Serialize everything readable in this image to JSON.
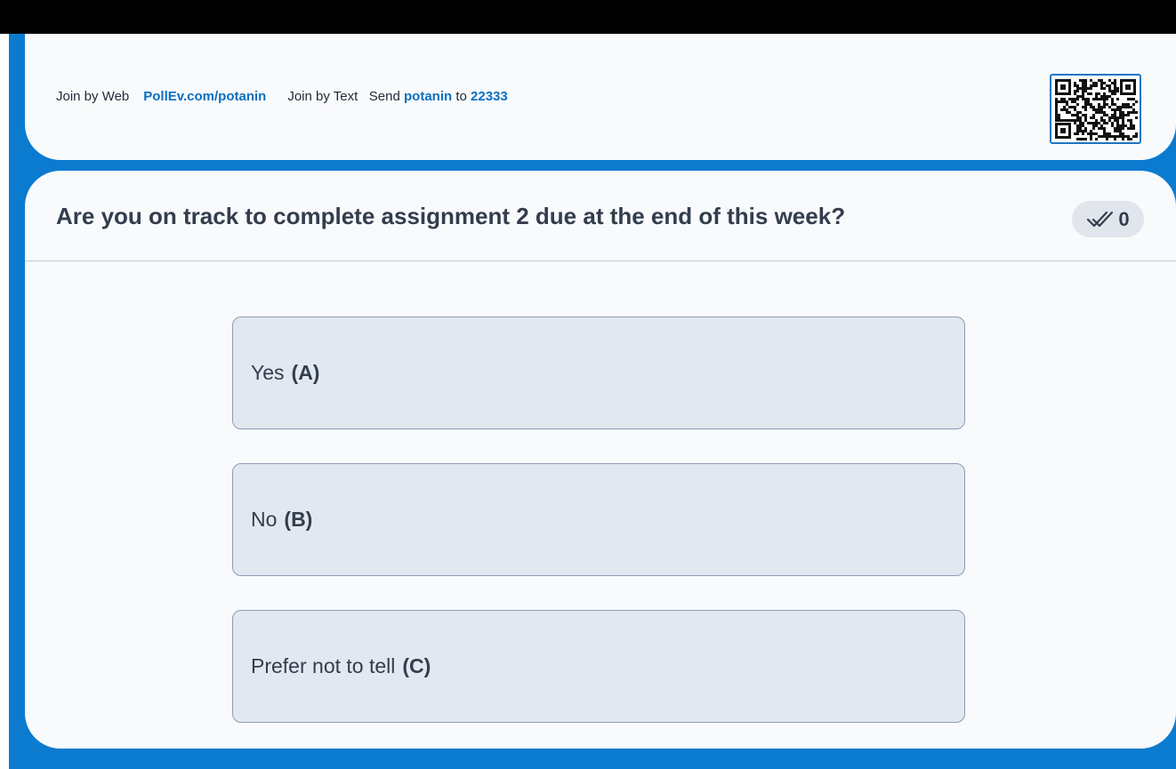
{
  "header": {
    "join_web_label": "Join by Web",
    "join_web_url": "PollEv.com/potanin",
    "join_text_label": "Join by Text",
    "send_word": "Send",
    "keyword": "potanin",
    "to_word": "to",
    "number": "22333",
    "qr_icon": "qr-code-icon"
  },
  "question": {
    "title": "Are you on track to complete assignment 2 due at the end of this week?",
    "response_count": "0",
    "response_icon": "double-check-icon"
  },
  "options": [
    {
      "text": "Yes",
      "key": "(A)"
    },
    {
      "text": "No",
      "key": "(B)"
    },
    {
      "text": "Prefer not to tell",
      "key": "(C)"
    }
  ],
  "colors": {
    "brand_blue": "#0b7bd0",
    "link_blue": "#0b6fc0",
    "card_bg": "#f8fafc",
    "option_bg": "#e1e8f0",
    "text_dark": "#333d4d"
  }
}
